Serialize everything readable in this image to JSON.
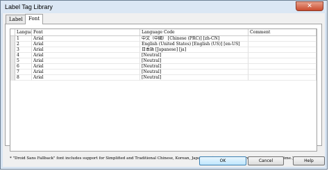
{
  "window": {
    "title": "Label Tag Library",
    "close_glyph": "✕"
  },
  "tabs": [
    {
      "label": "Label",
      "active": false
    },
    {
      "label": "Font",
      "active": true
    }
  ],
  "table": {
    "columns": [
      "Langua…",
      "Font",
      "Language Code",
      "Comment"
    ],
    "rows": [
      {
        "num": "1",
        "font": "Arial",
        "code": "中文（中國） [Chinese (PRC)] [zh-CN]",
        "comment": ""
      },
      {
        "num": "2",
        "font": "Arial",
        "code": "English (United States) [English (US)] [en-US]",
        "comment": ""
      },
      {
        "num": "3",
        "font": "Arial",
        "code": "日本語 [Japanese] [ja]",
        "comment": ""
      },
      {
        "num": "4",
        "font": "Arial",
        "code": "[Neutral]",
        "comment": ""
      },
      {
        "num": "5",
        "font": "Arial",
        "code": "[Neutral]",
        "comment": ""
      },
      {
        "num": "6",
        "font": "Arial",
        "code": "[Neutral]",
        "comment": ""
      },
      {
        "num": "7",
        "font": "Arial",
        "code": "[Neutral]",
        "comment": ""
      },
      {
        "num": "8",
        "font": "Arial",
        "code": "[Neutral]",
        "comment": ""
      }
    ]
  },
  "footnote": "* \"Droid Sans Fallback\" font includes support for Simplified and Traditional Chinese, Korean, Japanese. (This font will increase HMI startup time.)",
  "buttons": {
    "ok": "OK",
    "cancel": "Cancel",
    "help": "Help"
  }
}
